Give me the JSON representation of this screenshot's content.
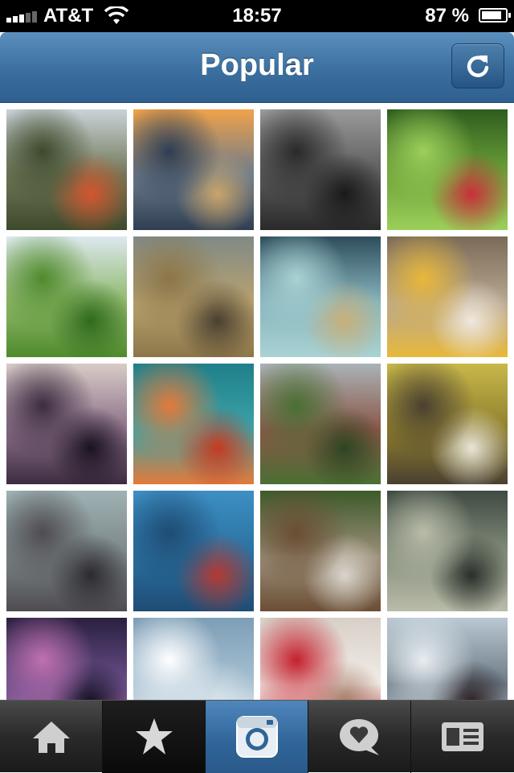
{
  "status_bar": {
    "carrier": "AT&T",
    "time": "18:57",
    "battery": "87 %",
    "battery_level": 0.87,
    "signal_bars": 3
  },
  "nav": {
    "title": "Popular",
    "refresh_icon": "refresh-icon"
  },
  "photos": [
    {
      "subject": "tree-and-orange-car",
      "colors": [
        "#c9d3d8",
        "#6f7656",
        "#3e4a2c",
        "#d2562e"
      ]
    },
    {
      "subject": "sunset-beach-reflection",
      "colors": [
        "#f0a24a",
        "#6b7b8c",
        "#2f3e52",
        "#c9a56a"
      ]
    },
    {
      "subject": "kayakers-dark-water",
      "colors": [
        "#9a9a9a",
        "#5a5a5a",
        "#2a2a2a",
        "#1a1a1a"
      ]
    },
    {
      "subject": "red-bike-in-grass",
      "colors": [
        "#2f5d1e",
        "#6ea33a",
        "#9ccf5a",
        "#c8303a"
      ]
    },
    {
      "subject": "rice-field-palms",
      "colors": [
        "#dce8ee",
        "#8fb86a",
        "#4f8a2c",
        "#2f6a1c"
      ]
    },
    {
      "subject": "girl-in-field",
      "colors": [
        "#7f8a86",
        "#b9a270",
        "#8c7648",
        "#4a4030"
      ]
    },
    {
      "subject": "babies-on-beanbags",
      "colors": [
        "#2e4d5c",
        "#87b6bd",
        "#a9d2d3",
        "#c8b07a"
      ]
    },
    {
      "subject": "cat-on-yellow-chair",
      "colors": [
        "#7a6a58",
        "#b8a890",
        "#e8b83a",
        "#efe8de"
      ]
    },
    {
      "subject": "bridge-silhouette",
      "colors": [
        "#d8ccc7",
        "#8b6f88",
        "#3c2c40",
        "#1a1220"
      ]
    },
    {
      "subject": "oranges-teal-grid",
      "colors": [
        "#1f7f8a",
        "#3ca3a8",
        "#e37a3a",
        "#c43b22"
      ]
    },
    {
      "subject": "brick-house",
      "colors": [
        "#aab3b7",
        "#8a5748",
        "#4a6f33",
        "#2e4522"
      ]
    },
    {
      "subject": "yellow-lecture-chairs",
      "colors": [
        "#c8b84a",
        "#8e7e2e",
        "#4a4030",
        "#e9e6d6"
      ]
    },
    {
      "subject": "motorcycle-beach",
      "colors": [
        "#9fb2b4",
        "#7a8486",
        "#4f4c50",
        "#2c2a30"
      ]
    },
    {
      "subject": "man-jumping-blue-wall",
      "colors": [
        "#3d8fc4",
        "#2a6f9f",
        "#1e4c74",
        "#b33a32"
      ]
    },
    {
      "subject": "dogs-collage",
      "colors": [
        "#3d5a2a",
        "#9c8f7a",
        "#6b4e34",
        "#d9d5cc"
      ]
    },
    {
      "subject": "hand-with-flower",
      "colors": [
        "#3f4a42",
        "#87917f",
        "#b9bca8",
        "#2a2e2a"
      ]
    },
    {
      "subject": "galaxy-nails",
      "colors": [
        "#2a2040",
        "#6a4f8a",
        "#c070b0",
        "#101020"
      ]
    },
    {
      "subject": "clouds-sky",
      "colors": [
        "#7d9eb6",
        "#a8c1d2",
        "#ffffff",
        "#d6e2ea"
      ]
    },
    {
      "subject": "heart-red-nails",
      "colors": [
        "#d8d0c8",
        "#f1ece7",
        "#c4202c",
        "#a67f6a"
      ]
    },
    {
      "subject": "woman-snowy-lake",
      "colors": [
        "#b9c8d2",
        "#6b7a86",
        "#e8eef2",
        "#2a1e20"
      ]
    }
  ],
  "tabs": [
    {
      "name": "home",
      "icon": "home-icon"
    },
    {
      "name": "popular",
      "icon": "star-icon"
    },
    {
      "name": "camera",
      "icon": "camera-icon"
    },
    {
      "name": "news",
      "icon": "heart-bubble-icon"
    },
    {
      "name": "profile",
      "icon": "profile-card-icon"
    }
  ]
}
